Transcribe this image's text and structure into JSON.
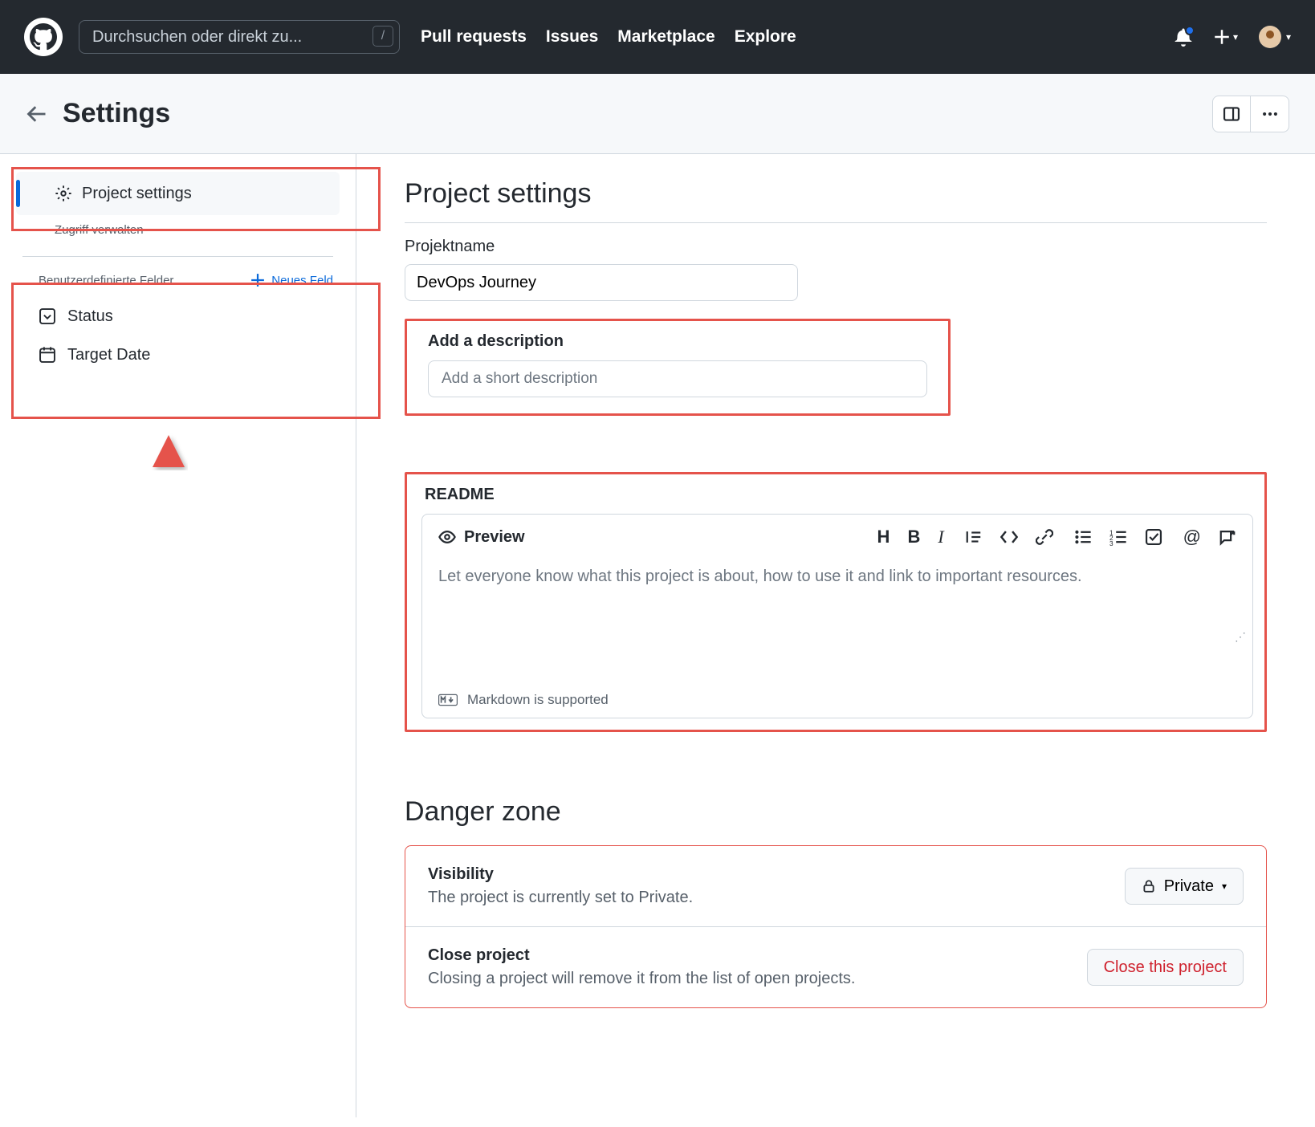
{
  "header": {
    "search_placeholder": "Durchsuchen oder direkt zu...",
    "nav": [
      "Pull requests",
      "Issues",
      "Marketplace",
      "Explore"
    ]
  },
  "subheader": {
    "title": "Settings"
  },
  "sidebar": {
    "project_settings": "Project settings",
    "manage_access": "Zugriff verwalten",
    "custom_fields_label": "Benutzerdefinierte Felder",
    "new_field": "Neues Feld",
    "fields": [
      {
        "icon": "caret-down-square-icon",
        "label": "Status"
      },
      {
        "icon": "calendar-icon",
        "label": "Target Date"
      }
    ]
  },
  "main": {
    "project_settings_title": "Project settings",
    "project_name_label": "Projektname",
    "project_name_value": "DevOps Journey",
    "description_label": "Add a description",
    "description_placeholder": "Add a short description",
    "readme_title": "README",
    "preview_label": "Preview",
    "readme_placeholder": "Let everyone know what this project is about, how to use it and link to important resources.",
    "markdown_supported": "Markdown is supported",
    "danger_zone_title": "Danger zone",
    "visibility": {
      "title": "Visibility",
      "desc": "The project is currently set to Private.",
      "button": "Private"
    },
    "close": {
      "title": "Close project",
      "desc": "Closing a project will remove it from the list of open projects.",
      "button": "Close this project"
    }
  }
}
